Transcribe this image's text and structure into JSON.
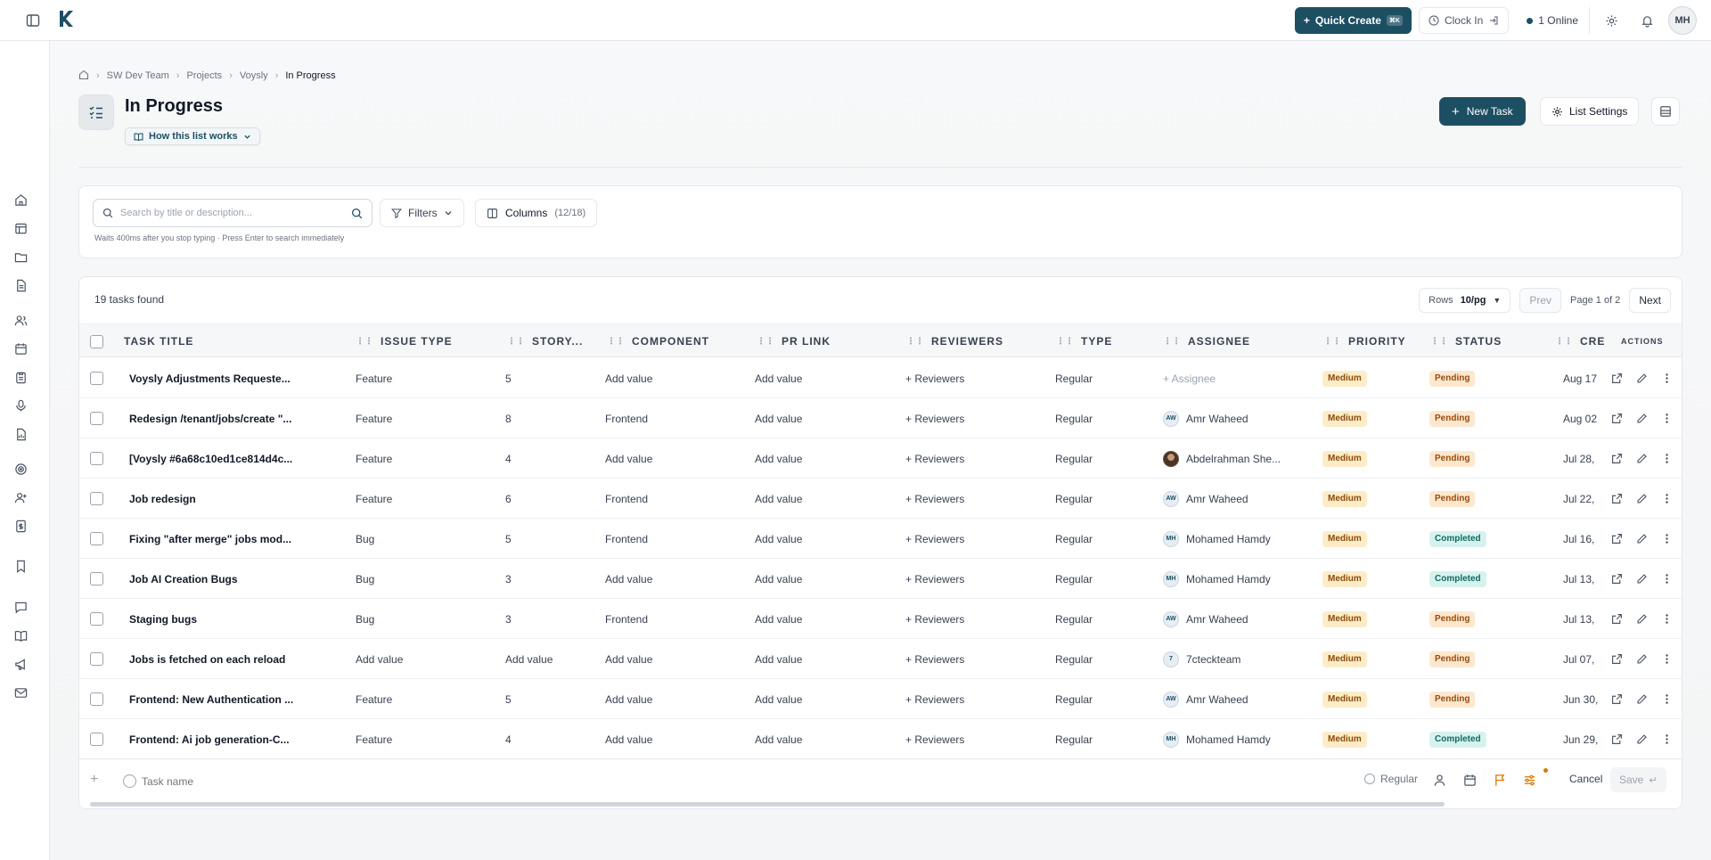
{
  "topbar": {
    "quick_create_label": "Quick Create",
    "quick_create_kbd": "⌘K",
    "clock_in_label": "Clock In",
    "online_label": "1 Online",
    "avatar_initials": "MH"
  },
  "breadcrumb": [
    "SW Dev Team",
    "Projects",
    "Voysly",
    "In Progress"
  ],
  "header": {
    "title": "In Progress",
    "how_label": "How this list works",
    "new_task_label": "New Task",
    "list_settings_label": "List Settings"
  },
  "search": {
    "placeholder": "Search by title or description...",
    "hint": "Waits 400ms after you stop typing · Press Enter to search immediately",
    "filters_label": "Filters",
    "columns_label": "Columns",
    "columns_count": "(12/18)"
  },
  "table": {
    "tasks_found": "19 tasks found",
    "rows_label": "Rows",
    "rows_value": "10/pg",
    "prev_label": "Prev",
    "page_label": "Page 1 of 2",
    "next_label": "Next",
    "columns": [
      "TASK TITLE",
      "ISSUE TYPE",
      "STORY...",
      "COMPONENT",
      "PR LINK",
      "REVIEWERS",
      "TYPE",
      "ASSIGNEE",
      "PRIORITY",
      "STATUS",
      "CREA",
      "ACTIONS"
    ],
    "rows": [
      {
        "title": "Voysly Adjustments Requeste...",
        "issue": "Feature",
        "story": "5",
        "component": "Add value",
        "pr": "Add value",
        "reviewers": "+ Reviewers",
        "type": "Regular",
        "assignee": "+ Assignee",
        "initials": "",
        "priority": "Medium",
        "status": "Pending",
        "created": "Aug 17"
      },
      {
        "title": "Redesign /tenant/jobs/create \"...",
        "issue": "Feature",
        "story": "8",
        "component": "Frontend",
        "pr": "Add value",
        "reviewers": "+ Reviewers",
        "type": "Regular",
        "assignee": "Amr Waheed",
        "initials": "AW",
        "priority": "Medium",
        "status": "Pending",
        "created": "Aug 02"
      },
      {
        "title": "[Voysly #6a68c10ed1ce814d4c...",
        "issue": "Feature",
        "story": "4",
        "component": "Add value",
        "pr": "Add value",
        "reviewers": "+ Reviewers",
        "type": "Regular",
        "assignee": "Abdelrahman She...",
        "initials": "",
        "priority": "Medium",
        "status": "Pending",
        "created": "Jul 28,"
      },
      {
        "title": "Job redesign",
        "issue": "Feature",
        "story": "6",
        "component": "Frontend",
        "pr": "Add value",
        "reviewers": "+ Reviewers",
        "type": "Regular",
        "assignee": "Amr Waheed",
        "initials": "AW",
        "priority": "Medium",
        "status": "Pending",
        "created": "Jul 22,"
      },
      {
        "title": "Fixing \"after merge\" jobs mod...",
        "issue": "Bug",
        "story": "5",
        "component": "Frontend",
        "pr": "Add value",
        "reviewers": "+ Reviewers",
        "type": "Regular",
        "assignee": "Mohamed Hamdy",
        "initials": "MH",
        "priority": "Medium",
        "status": "Completed",
        "created": "Jul 16,"
      },
      {
        "title": "Job AI Creation Bugs",
        "issue": "Bug",
        "story": "3",
        "component": "Add value",
        "pr": "Add value",
        "reviewers": "+ Reviewers",
        "type": "Regular",
        "assignee": "Mohamed Hamdy",
        "initials": "MH",
        "priority": "Medium",
        "status": "Completed",
        "created": "Jul 13,"
      },
      {
        "title": "Staging bugs",
        "issue": "Bug",
        "story": "3",
        "component": "Frontend",
        "pr": "Add value",
        "reviewers": "+ Reviewers",
        "type": "Regular",
        "assignee": "Amr Waheed",
        "initials": "AW",
        "priority": "Medium",
        "status": "Pending",
        "created": "Jul 13,"
      },
      {
        "title": "Jobs is fetched on each reload",
        "issue": "Add value",
        "story": "Add value",
        "component": "Add value",
        "pr": "Add value",
        "reviewers": "+ Reviewers",
        "type": "Regular",
        "assignee": "7cteckteam",
        "initials": "7",
        "priority": "Medium",
        "status": "Pending",
        "created": "Jul 07,"
      },
      {
        "title": "Frontend: New Authentication ...",
        "issue": "Feature",
        "story": "5",
        "component": "Add value",
        "pr": "Add value",
        "reviewers": "+ Reviewers",
        "type": "Regular",
        "assignee": "Amr Waheed",
        "initials": "AW",
        "priority": "Medium",
        "status": "Pending",
        "created": "Jun 30,"
      },
      {
        "title": "Frontend: Ai job generation-C...",
        "issue": "Feature",
        "story": "4",
        "component": "Add value",
        "pr": "Add value",
        "reviewers": "+ Reviewers",
        "type": "Regular",
        "assignee": "Mohamed Hamdy",
        "initials": "MH",
        "priority": "Medium",
        "status": "Completed",
        "created": "Jun 29,"
      }
    ]
  },
  "quick_add": {
    "placeholder": "Task name",
    "type_label": "Regular",
    "cancel_label": "Cancel",
    "save_label": "Save"
  },
  "colors": {
    "brand": "#1d4f63",
    "pending_bg": "#fde8cf",
    "completed_bg": "#d7f2ee",
    "medium_bg": "#fdecc8"
  }
}
